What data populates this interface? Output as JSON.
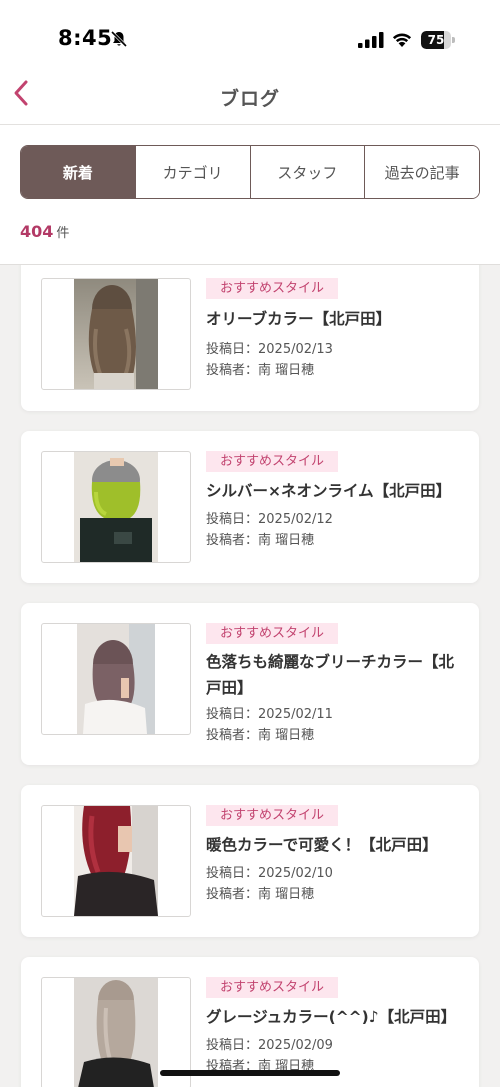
{
  "status_bar": {
    "time": "8:45",
    "battery": "75",
    "battery_level": 0.75,
    "icons": [
      "bell-slash-icon",
      "signal-icon",
      "wifi-icon",
      "battery-icon"
    ]
  },
  "header": {
    "title": "ブログ",
    "back_icon": "chevron-left-icon"
  },
  "tabs": [
    {
      "label": "新着",
      "active": true
    },
    {
      "label": "カテゴリ",
      "active": false
    },
    {
      "label": "スタッフ",
      "active": false
    },
    {
      "label": "過去の記事",
      "active": false
    }
  ],
  "count": {
    "number": "404",
    "unit": "件"
  },
  "posts": [
    {
      "tag": "おすすめスタイル",
      "title": "オリーブカラー【北戸田】",
      "date": "投稿日：2025/02/13",
      "author": "投稿者：南 瑠日穂"
    },
    {
      "tag": "おすすめスタイル",
      "title": "シルバー×ネオンライム【北戸田】",
      "date": "投稿日：2025/02/12",
      "author": "投稿者：南 瑠日穂"
    },
    {
      "tag": "おすすめスタイル",
      "title": "色落ちも綺麗なブリーチカラー【北戸田】",
      "date": "投稿日：2025/02/11",
      "author": "投稿者：南 瑠日穂"
    },
    {
      "tag": "おすすめスタイル",
      "title": "暖色カラーで可愛く！【北戸田】",
      "date": "投稿日：2025/02/10",
      "author": "投稿者：南 瑠日穂"
    },
    {
      "tag": "おすすめスタイル",
      "title": "グレージュカラー(^^)♪【北戸田】",
      "date": "投稿日：2025/02/09",
      "author": "投稿者：南 瑠日穂"
    }
  ],
  "colors": {
    "accent": "#b33a66",
    "tab_active": "#6e5a58",
    "tag_bg": "#fde6ee",
    "back_arrow": "#c2436f"
  }
}
